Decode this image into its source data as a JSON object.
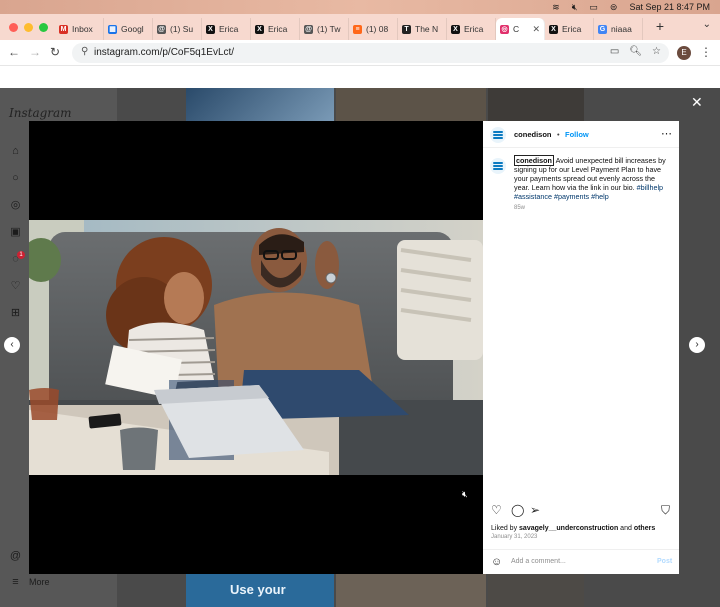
{
  "menubar": {
    "datetime": "Sat Sep 21  8:47 PM"
  },
  "browser": {
    "tabs": [
      {
        "label": "Inbox",
        "icon": "gmail-icon",
        "color": "#d93025",
        "glyph": "M"
      },
      {
        "label": "Googl",
        "icon": "sheets-icon",
        "color": "#1a73e8",
        "glyph": "▦"
      },
      {
        "label": "(1) Su",
        "icon": "threads-icon",
        "color": "#555555",
        "glyph": "@"
      },
      {
        "label": "Erica",
        "icon": "x-icon",
        "color": "#111111",
        "glyph": "X"
      },
      {
        "label": "Erica",
        "icon": "x-icon",
        "color": "#111111",
        "glyph": "X"
      },
      {
        "label": "(1) Tw",
        "icon": "threads-icon",
        "color": "#555555",
        "glyph": "@"
      },
      {
        "label": "(1) 08",
        "icon": "substack-icon",
        "color": "#ff6719",
        "glyph": "≡"
      },
      {
        "label": "The N",
        "icon": "nyt-icon",
        "color": "#222222",
        "glyph": "T"
      },
      {
        "label": "Erica",
        "icon": "x-icon",
        "color": "#111111",
        "glyph": "X"
      },
      {
        "label": "C",
        "icon": "instagram-icon",
        "color": "#e1306c",
        "glyph": "◎",
        "active": true
      },
      {
        "label": "Erica",
        "icon": "x-icon",
        "color": "#111111",
        "glyph": "X"
      },
      {
        "label": "niaaa",
        "icon": "google-icon",
        "color": "#4285f4",
        "glyph": "G"
      }
    ],
    "url": "instagram.com/p/CoF5q1EvLct/",
    "profile_initial": "E"
  },
  "instagram": {
    "logo": "Instagram",
    "more_label": "More",
    "notification_count": "1"
  },
  "post": {
    "username": "conedison",
    "follow_label": "Follow",
    "caption_user": "conedison",
    "caption_text": "Avoid unexpected bill increases by signing up for our Level Payment Plan to have your payments spread out evenly across the year. Learn how via the link in our bio. ",
    "caption_tags": "#billhelp #assistance #payments #help",
    "caption_age": "85w",
    "liked_by_prefix": "Liked by ",
    "liked_by_user": "savagely__underconstruction",
    "liked_by_and": " and ",
    "liked_by_others": "others",
    "date": "January 31, 2023",
    "comment_placeholder": "Add a comment...",
    "post_button": "Post"
  },
  "background_feed": {
    "tile_text": "Use your"
  },
  "colors": {
    "accent_blue": "#0095f6",
    "brand_blue": "#0b7ac1"
  }
}
